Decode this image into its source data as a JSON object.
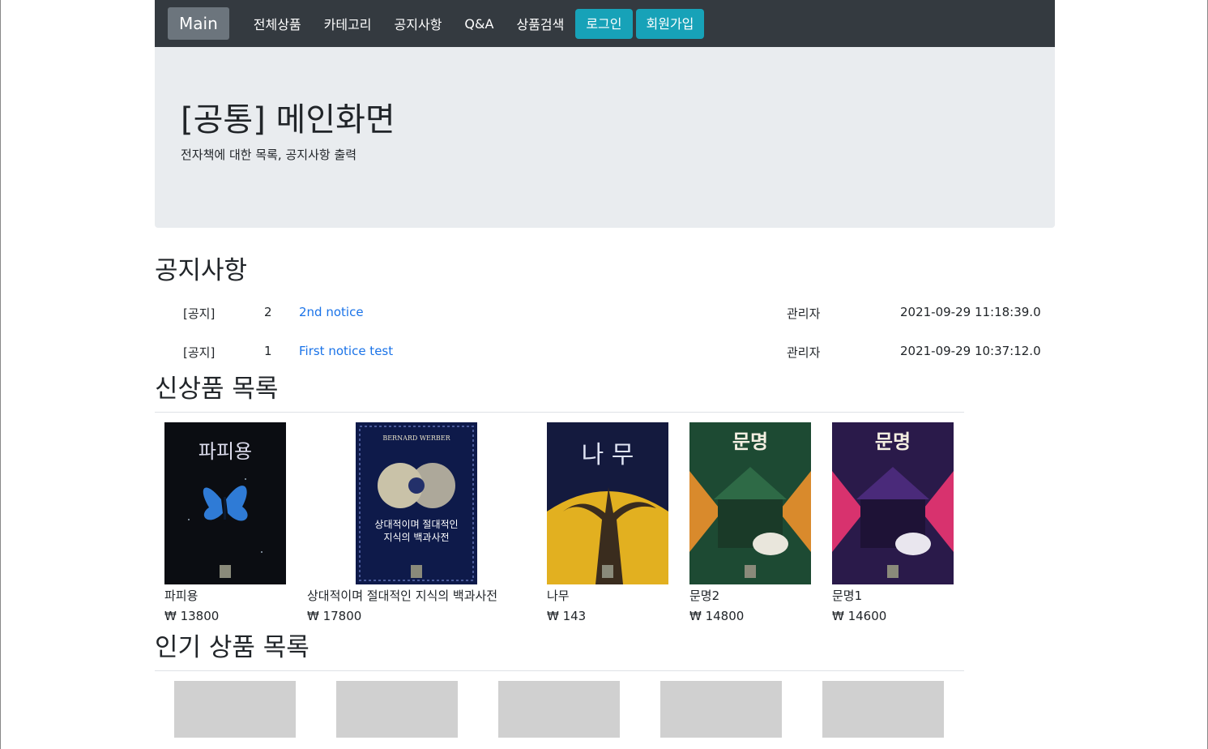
{
  "nav": {
    "brand": "Main",
    "links": [
      "전체상품",
      "카테고리",
      "공지사항",
      "Q&A",
      "상품검색"
    ],
    "login": "로그인",
    "signup": "회원가입"
  },
  "jumbotron": {
    "title": "[공통] 메인화면",
    "subtitle": "전자책에 대한 목록, 공지사항 출력"
  },
  "notices": {
    "heading": "공지사항",
    "rows": [
      {
        "tag": "[공지]",
        "num": "2",
        "title": "2nd notice",
        "author": "관리자",
        "date": "2021-09-29 11:18:39.0"
      },
      {
        "tag": "[공지]",
        "num": "1",
        "title": "First notice test",
        "author": "관리자",
        "date": "2021-09-29 10:37:12.0"
      }
    ]
  },
  "new_products": {
    "heading": "신상품 목록",
    "items": [
      {
        "name": "파피용",
        "price": "₩ 13800",
        "cover_title": "파피용",
        "cover_colors": [
          "#0b0d12",
          "#1a2a55",
          "#2f7bd6"
        ]
      },
      {
        "name": "상대적이며 절대적인 지식의 백과사전",
        "price": "₩ 17800",
        "cover_title": "상대적이며 절대적인 지식의 백과사전",
        "cover_top": "BERNARD WERBER",
        "cover_colors": [
          "#0e1a4a",
          "#23306a",
          "#c9c2a8"
        ]
      },
      {
        "name": "나무",
        "price": "₩ 143",
        "cover_title": "나 무",
        "cover_colors": [
          "#141a3e",
          "#e2b020",
          "#3a2c1e"
        ]
      },
      {
        "name": "문명2",
        "price": "₩ 14800",
        "cover_title": "문명",
        "cover_colors": [
          "#1d4a33",
          "#d98a2c",
          "#e9e6dc"
        ]
      },
      {
        "name": "문명1",
        "price": "₩ 14600",
        "cover_title": "문명",
        "cover_colors": [
          "#2a1a4a",
          "#d8326e",
          "#e9e6ee"
        ]
      }
    ]
  },
  "popular_products": {
    "heading": "인기 상품 목록",
    "count": 5
  }
}
